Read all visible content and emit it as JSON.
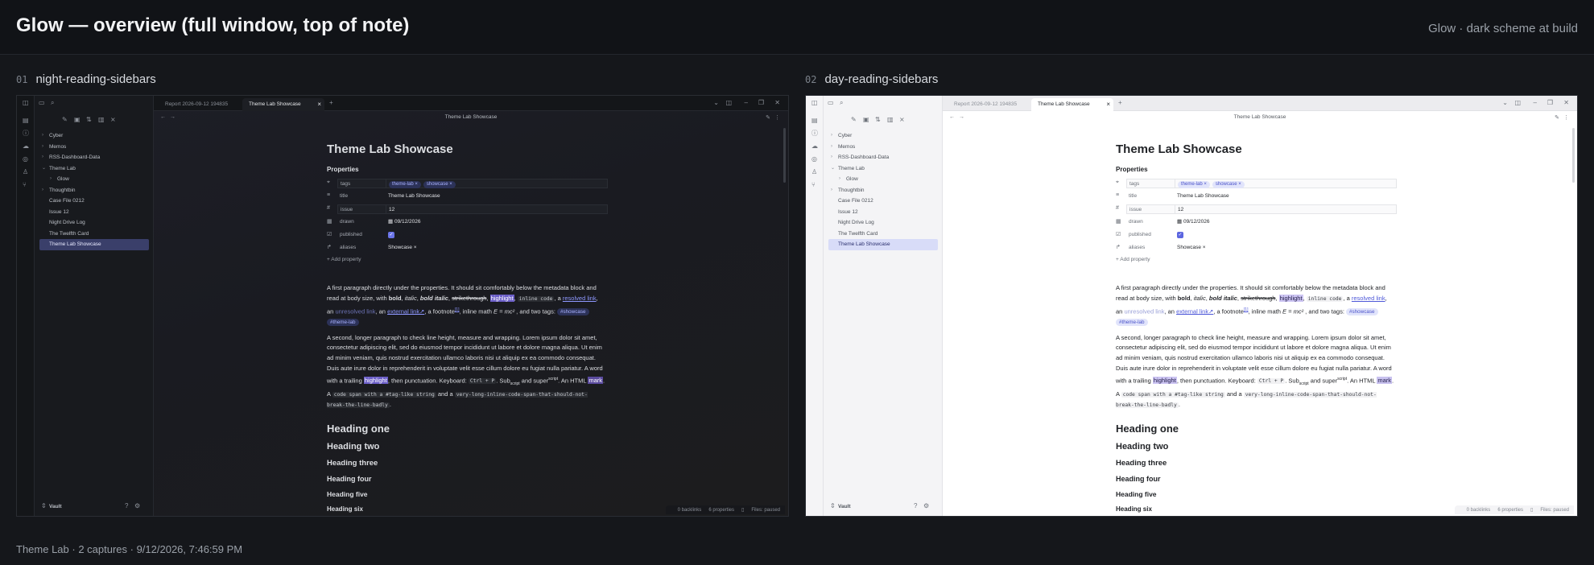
{
  "header": {
    "title": "Glow — overview (full window, top of note)",
    "subtitle": "Glow · dark scheme at build"
  },
  "captures": [
    {
      "num": "01",
      "name": "night-reading-sidebars",
      "theme": "dark"
    },
    {
      "num": "02",
      "name": "day-reading-sidebars",
      "theme": "light"
    }
  ],
  "footer": "Theme Lab · 2 captures · 9/12/2026, 7:46:59 PM",
  "app": {
    "tabs": [
      "Report 2026-09-12 194835",
      "Theme Lab Showcase"
    ],
    "view_title": "Theme Lab Showcase",
    "sidebar": {
      "items": [
        {
          "label": "Cyber",
          "chevron": "›"
        },
        {
          "label": "Memos",
          "chevron": "›"
        },
        {
          "label": "RSS-Dashboard-Data",
          "chevron": "›"
        },
        {
          "label": "Theme Lab",
          "chevron": "⌄"
        },
        {
          "label": "Glow",
          "chevron": "›"
        },
        {
          "label": "Thoughtbin",
          "chevron": "›"
        },
        {
          "label": "Case File 0212",
          "chevron": ""
        },
        {
          "label": "Issue 12",
          "chevron": ""
        },
        {
          "label": "Night Drive Log",
          "chevron": ""
        },
        {
          "label": "The Twelfth Card",
          "chevron": ""
        },
        {
          "label": "Theme Lab Showcase",
          "chevron": ""
        }
      ],
      "vault_label": "Vault"
    },
    "note": {
      "title": "Theme Lab Showcase",
      "properties_heading": "Properties",
      "properties": {
        "tags": {
          "key": "tags",
          "values": [
            "theme-lab ×",
            "showcase ×"
          ]
        },
        "title": {
          "key": "title",
          "value": "Theme Lab Showcase"
        },
        "issue": {
          "key": "issue",
          "value": "12"
        },
        "drawn": {
          "key": "drawn",
          "value": "09/12/2026"
        },
        "published": {
          "key": "published",
          "checked": true
        },
        "aliases": {
          "key": "aliases",
          "value": "Showcase ×"
        }
      },
      "add_property": "Add property",
      "p1": {
        "a": "A first paragraph directly under the properties. It should sit comfortably below the metadata block and read at body size, with ",
        "bold": "bold",
        "italic": "italic",
        "bold_italic": "bold italic",
        "strike": "strikethrough",
        "highlight": "highlight",
        "code": "inline code",
        "resolved": "resolved link",
        "unresolved": "unresolved link",
        "external": "external link↗",
        "footnote_label": "a footnote",
        "footnote_ref": "[1]",
        "math": "E = mc²",
        "tags_intro": ", and two tags:",
        "tag1": "#showcase",
        "tag2": "#theme-lab"
      },
      "p2": {
        "a": "A second, longer paragraph to check line height, measure and wrapping. Lorem ipsum dolor sit amet, consectetur adipiscing elit, sed do eiusmod tempor incididunt ut labore et dolore magna aliqua. Ut enim ad minim veniam, quis nostrud exercitation ullamco laboris nisi ut aliquip ex ea commodo consequat. Duis aute irure dolor in reprehenderit in voluptate velit esse cillum dolore eu fugiat nulla pariatur. A word with a trailing ",
        "highlight": "highlight",
        "b": ", then punctuation. Keyboard: ",
        "kbd": "Ctrl + P",
        "c": ". Sub",
        "sub": "script",
        "d": " and super",
        "sup": "script",
        "e": ". An HTML ",
        "mark": "mark",
        "f": ". A ",
        "code1": "code span with a #tag-like string",
        "g": " and a ",
        "code2": "very-long-inline-code-span-that-should-not-break-the-line-badly",
        "h": "."
      },
      "headings": [
        "Heading one",
        "Heading two",
        "Heading three",
        "Heading four",
        "Heading five",
        "Heading six"
      ]
    },
    "status": {
      "backlinks": "0 backlinks",
      "properties": "6 properties",
      "files": "Files: paused"
    }
  }
}
